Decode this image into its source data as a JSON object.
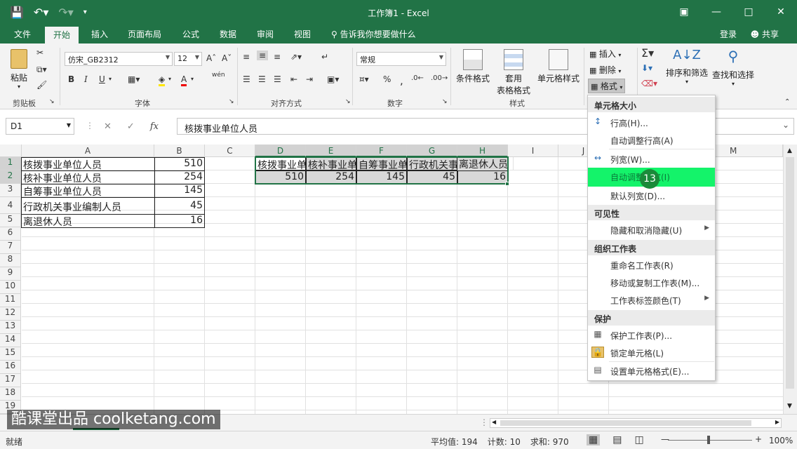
{
  "window": {
    "title": "工作簿1 - Excel",
    "qat": [
      "save-icon",
      "undo-icon",
      "redo-icon",
      "customize-icon"
    ]
  },
  "tabs": {
    "file": "文件",
    "home": "开始",
    "insert": "插入",
    "page_layout": "页面布局",
    "formulas": "公式",
    "data": "数据",
    "review": "审阅",
    "view": "视图",
    "tell_me": "告诉我你想要做什么",
    "login": "登录",
    "share": "共享"
  },
  "ribbon": {
    "clipboard": {
      "paste": "粘贴",
      "label": "剪贴板"
    },
    "font": {
      "name": "仿宋_GB2312",
      "size": "12",
      "label": "字体",
      "bold": "B",
      "italic": "I",
      "underline": "U",
      "wen": "wén"
    },
    "alignment": {
      "label": "对齐方式"
    },
    "number": {
      "format": "常规",
      "label": "数字"
    },
    "styles": {
      "conditional": "条件格式",
      "table1": "套用",
      "table2": "表格格式",
      "cell_styles": "单元格样式",
      "label": "样式"
    },
    "cells": {
      "insert": "插入",
      "delete": "删除",
      "format": "格式"
    },
    "editing": {
      "sort_filter": "排序和筛选",
      "find_select": "查找和选择"
    }
  },
  "formula_bar": {
    "name_box": "D1",
    "content": "核拨事业单位人员",
    "fx": "fx"
  },
  "columns": [
    "A",
    "B",
    "C",
    "D",
    "E",
    "F",
    "G",
    "H",
    "I",
    "J",
    "M"
  ],
  "rows": [
    "1",
    "2",
    "3",
    "4",
    "5",
    "6",
    "7",
    "8",
    "9",
    "10",
    "11",
    "12",
    "13",
    "14",
    "15",
    "16",
    "17",
    "18",
    "19"
  ],
  "sheet": {
    "source": [
      {
        "label": "核拨事业单位人员",
        "value": "510"
      },
      {
        "label": "核补事业单位人员",
        "value": "254"
      },
      {
        "label": "自筹事业单位人员",
        "value": "145"
      },
      {
        "label": "行政机关事业编制人员",
        "value": "45"
      },
      {
        "label": "离退休人员",
        "value": "16"
      }
    ],
    "transposed_headers": [
      "核拨事业单",
      "核补事业单",
      "自筹事业单",
      "行政机关事",
      "离退休人员"
    ],
    "transposed_values": [
      "510",
      "254",
      "145",
      "45",
      "16"
    ]
  },
  "menu": {
    "sections": {
      "size": "单元格大小",
      "visibility": "可见性",
      "organize": "组织工作表",
      "protection": "保护"
    },
    "items": {
      "row_height": "行高(H)...",
      "autofit_row": "自动调整行高(A)",
      "col_width": "列宽(W)...",
      "autofit_col": "自动调整列宽(I)",
      "default_width": "默认列宽(D)...",
      "hide_unhide": "隐藏和取消隐藏(U)",
      "rename": "重命名工作表(R)",
      "move_copy": "移动或复制工作表(M)...",
      "tab_color": "工作表标签颜色(T)",
      "protect_sheet": "保护工作表(P)...",
      "lock_cell": "锁定单元格(L)",
      "format_cells": "设置单元格格式(E)..."
    },
    "step_badge": "13",
    "highlight_color": "#14f36a"
  },
  "status": {
    "ready": "就绪",
    "average": "平均值: 194",
    "count": "计数: 10",
    "sum": "求和: 970",
    "zoom": "100%"
  },
  "watermark": "酷课堂出品 coolketang.com",
  "colors": {
    "brand": "#217346",
    "selection": "#217346"
  }
}
